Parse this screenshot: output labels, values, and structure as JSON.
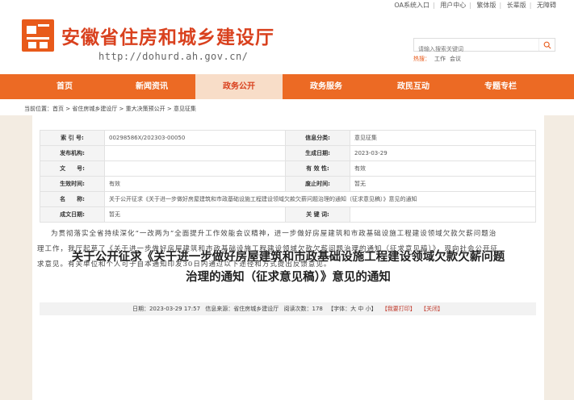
{
  "topbar": {
    "links": [
      "OA系统入口",
      "用户中心",
      "繁体版",
      "长辈版",
      "无障碍"
    ]
  },
  "header": {
    "site_title": "安徽省住房和城乡建设厅",
    "site_url": "http://dohurd.ah.gov.cn/",
    "search_placeholder": "请输入搜索关键词",
    "hot_label": "热搜：",
    "hot_terms": [
      "工作",
      "会议"
    ]
  },
  "nav": {
    "items": [
      "首页",
      "新闻资讯",
      "政务公开",
      "政务服务",
      "政民互动",
      "专题专栏"
    ],
    "active_index": 2
  },
  "breadcrumb": "当前位置：首页 > 省住房城乡建设厅 > 重大决策预公开 > 意见征集",
  "info": {
    "rows": [
      [
        "索 引 号:",
        "00298586X/202303-00050",
        "信息分类:",
        "意见征集"
      ],
      [
        "发布机构:",
        "",
        "生成日期:",
        "2023-03-29"
      ],
      [
        "文　　号:",
        "",
        "有 效 性:",
        "有效"
      ],
      [
        "生效时间:",
        "有效",
        "废止时间:",
        "暂无"
      ],
      [
        "名　　称:",
        "关于公开征求《关于进一步做好房屋建筑和市政基础设施工程建设领域欠款欠薪问题治理的通知（征求意见稿）》意见的通知"
      ],
      [
        "成文日期:",
        "暂无",
        "关 键 词:",
        ""
      ]
    ]
  },
  "article": {
    "title_line1": "关于公开征求《关于进一步做好房屋建筑和市政基础设施工程建设领域欠款欠薪问题",
    "title_line2": "治理的通知（征求意见稿）》意见的通知",
    "meta_date": "日期：2023-03-29 17:57",
    "meta_source": "信息来源：省住房城乡建设厅",
    "meta_views": "阅读次数：178",
    "meta_font": "【字体：大 中 小】",
    "meta_print": "【我要打印】",
    "meta_close": "【关闭】",
    "body": "为贯彻落实全省持续深化“一改两为”全面提升工作效能会议精神，进一步做好房屋建筑和市政基础设施工程建设领域欠款欠薪问题治理工作，我厅起草了《关于进一步做好房屋建筑和市政基础设施工程建设领域欠款欠薪问题治理的通知（征求意见稿）》，现向社会公开征求意见。有关单位和个人可于自本通知印发30日内通过以下途径和方式提出反馈意见。"
  }
}
